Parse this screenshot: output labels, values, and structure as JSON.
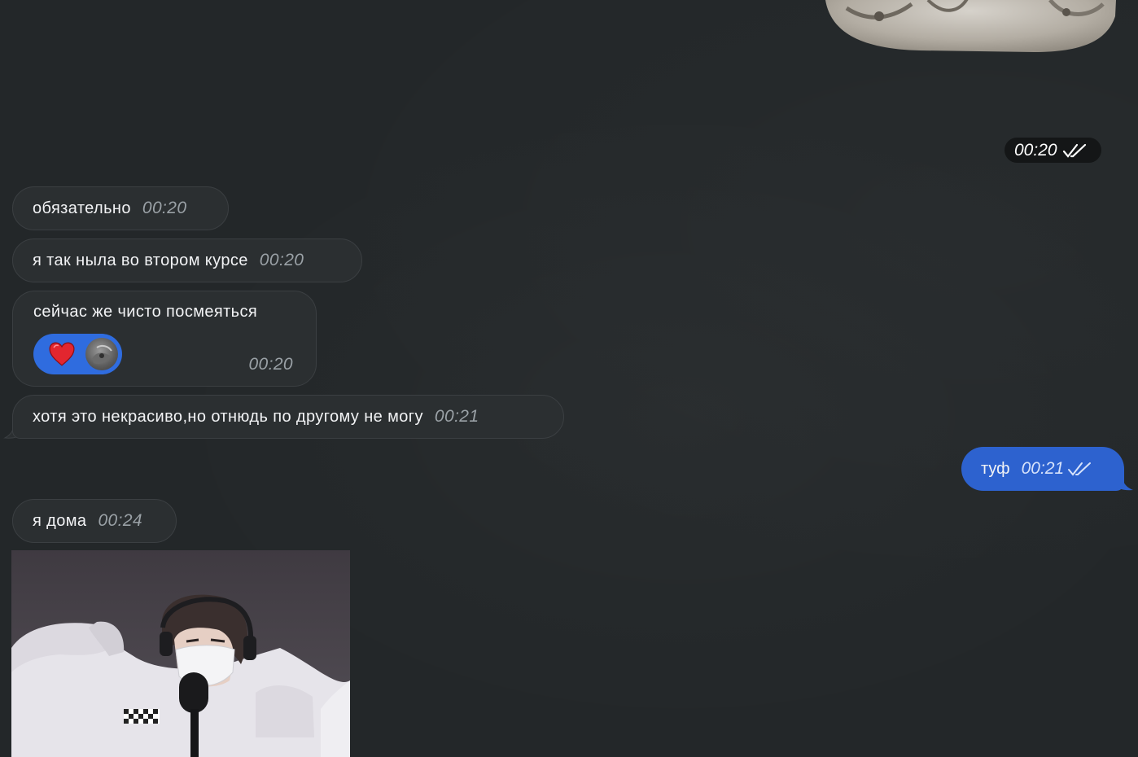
{
  "top_sticker": {
    "time": "00:20",
    "status_icon": "double-check-icon"
  },
  "messages": [
    {
      "text": "обязательно",
      "time": "00:20",
      "direction": "incoming"
    },
    {
      "text": "я так ныла во втором курсе",
      "time": "00:20",
      "direction": "incoming"
    },
    {
      "text": "сейчас же чисто посмеяться",
      "time": "00:20",
      "direction": "incoming",
      "reactions": {
        "emoji": "heart-icon",
        "reactor": "avatar"
      }
    },
    {
      "text": "хотя это некрасиво,но отнюдь по другому не могу",
      "time": "00:21",
      "direction": "incoming"
    },
    {
      "text": "туф",
      "time": "00:21",
      "direction": "outgoing",
      "status_icon": "double-check-icon"
    },
    {
      "text": "я дома",
      "time": "00:24",
      "direction": "incoming"
    }
  ],
  "colors": {
    "background": "#232729",
    "incoming_bubble": "#2b2f31",
    "outgoing_bubble": "#2d62cf",
    "reaction_pill": "#2f6cdf",
    "time_pill": "#141617"
  }
}
